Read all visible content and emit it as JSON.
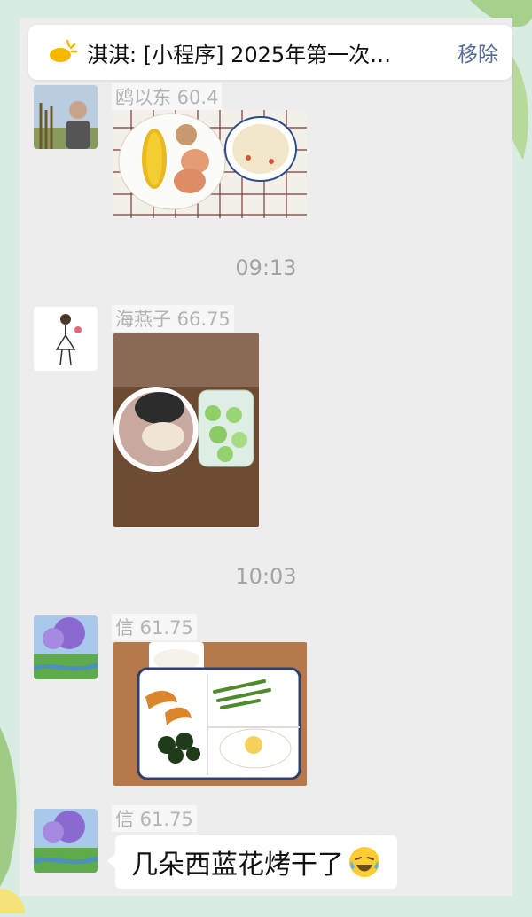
{
  "pinned": {
    "text": "淇淇: [小程序] 2025年第一次…",
    "action": "移除",
    "icon": "mini-program-icon"
  },
  "messages": [
    {
      "nickname": "鸥以东 60.4",
      "avatar": "avatar-person-icon",
      "photo": "breakfast-corn-eggs-soup"
    },
    {
      "time": "09:13"
    },
    {
      "nickname": "海燕子 66.75",
      "avatar": "avatar-girl-icon",
      "photo": "breakfast-porridge-cucumber"
    },
    {
      "time": "10:03"
    },
    {
      "nickname": "信 61.75",
      "avatar": "avatar-landscape-icon",
      "photo": "breakfast-milk-pumpkin-broccoli"
    },
    {
      "nickname": "信 61.75",
      "avatar": "avatar-landscape-icon",
      "text": "几朵西蓝花烤干了",
      "emoji": "laughing-crying-emoji"
    }
  ],
  "colors": {
    "pin_action": "#576b95",
    "chat_bg": "#ededed",
    "outer_bg": "#d9ece2"
  }
}
